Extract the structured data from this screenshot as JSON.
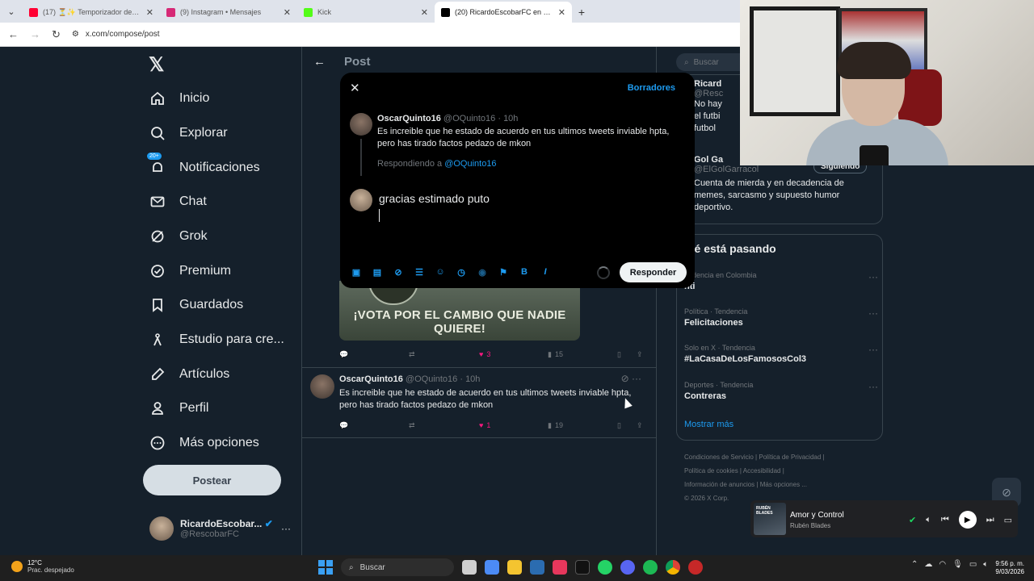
{
  "browser": {
    "tabs": [
      {
        "title": "(17) ⏳✨ Temporizador de 10",
        "color": "#ff0033"
      },
      {
        "title": "(9) Instagram • Mensajes",
        "color": "#d62976"
      },
      {
        "title": "Kick",
        "color": "#53fc18"
      },
      {
        "title": "(20) RicardoEscobarFC en X: \"V",
        "color": "#000000"
      }
    ],
    "new_tab": "+",
    "url": "x.com/compose/post"
  },
  "nav": {
    "items": [
      {
        "label": "Inicio",
        "icon": "home-icon"
      },
      {
        "label": "Explorar",
        "icon": "search-icon"
      },
      {
        "label": "Notificaciones",
        "icon": "bell-icon",
        "badge": "20+"
      },
      {
        "label": "Chat",
        "icon": "mail-icon"
      },
      {
        "label": "Grok",
        "icon": "grok-icon"
      },
      {
        "label": "Premium",
        "icon": "premium-icon"
      },
      {
        "label": "Guardados",
        "icon": "bookmark-icon"
      },
      {
        "label": "Estudio para cre...",
        "icon": "studio-icon"
      },
      {
        "label": "Artículos",
        "icon": "articles-icon"
      },
      {
        "label": "Perfil",
        "icon": "profile-icon"
      },
      {
        "label": "Más opciones",
        "icon": "more-icon"
      }
    ],
    "post_button": "Postear",
    "profile": {
      "name": "RicardoEscobar...",
      "handle": "@RescobarFC"
    }
  },
  "center": {
    "header": "Post",
    "banner_text": "¡VOTA POR EL CAMBIO QUE NADIE QUIERE!",
    "first_actions": {
      "likes": "3",
      "views": "15"
    },
    "tweet": {
      "name": "OscarQuinto16",
      "meta": "@OQuinto16 · 10h",
      "body": "Es increible que he estado de acuerdo en tus ultimos tweets inviable hpta, pero has tirado factos pedazo de mkon",
      "likes": "1",
      "views": "19"
    }
  },
  "right": {
    "search_placeholder": "Buscar",
    "who": [
      {
        "name": "Ricard",
        "handle": "@Resc",
        "bio": "No hay\nel futbi\nfutbol"
      },
      {
        "name": "Gol Ga",
        "handle": "@ElGolGarracol",
        "follow": "Siguiendo",
        "bio": "Cuenta de mierda y en decadencia de memes, sarcasmo y supuesto humor deportivo."
      }
    ],
    "trends_title": "ué está pasando",
    "trends": [
      {
        "category": "endencia en Colombia",
        "title": "nti"
      },
      {
        "category": "Política · Tendencia",
        "title": "Felicitaciones"
      },
      {
        "category": "Solo en X · Tendencia",
        "title": "#LaCasaDeLosFamososCol3"
      },
      {
        "category": "Deportes · Tendencia",
        "title": "Contreras"
      }
    ],
    "show_more": "Mostrar más",
    "footer": [
      "Condiciones de Servicio",
      "Política de Privacidad",
      "Política de cookies",
      "Accesibilidad",
      "Información de anuncios",
      "Más opciones ...",
      "© 2026 X Corp."
    ]
  },
  "compose": {
    "drafts": "Borradores",
    "original": {
      "name": "OscarQuinto16",
      "meta": "@OQuinto16 · 10h",
      "body": "Es increible que he estado de acuerdo en tus ultimos tweets inviable hpta, pero has tirado factos pedazo de mkon"
    },
    "replying_to_label": "Respondiendo a",
    "replying_to_handle": "@OQuinto16",
    "reply_text": "gracias estimado puto",
    "reply_button": "Responder",
    "tool_bold": "B",
    "tool_italic": "I"
  },
  "player": {
    "song": "Amor y Control",
    "artist": "Rubén Blades",
    "cover_title": "RUBÉN BLADES"
  },
  "taskbar": {
    "temp": "12°C",
    "weather": "Prac. despejado",
    "search": "Buscar",
    "time": "9:56 p. m.",
    "date": "9/03/2026"
  }
}
